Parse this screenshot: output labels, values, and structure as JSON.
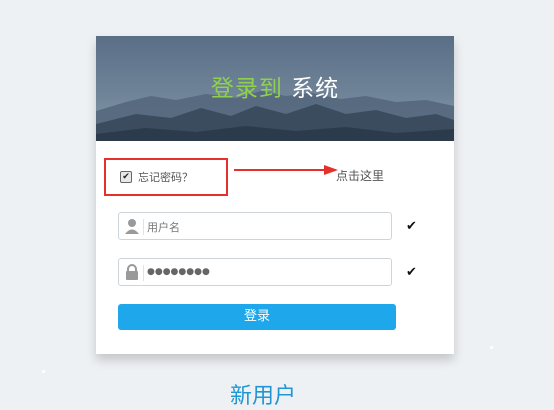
{
  "banner": {
    "title_highlight": "登录到",
    "title_rest": "系统"
  },
  "remember": {
    "label": "忘记密码？",
    "checked": true
  },
  "hint_text": "点击这里",
  "username": {
    "placeholder": "用户名",
    "icon": "user-icon"
  },
  "password": {
    "masked_value": "●●●●●●●●",
    "icon": "lock-icon"
  },
  "login_button_label": "登录",
  "new_user_label": "新用户",
  "colors": {
    "accent": "#1ea7ea",
    "title_highlight": "#8fd14f",
    "annotation": "#e5302b"
  }
}
